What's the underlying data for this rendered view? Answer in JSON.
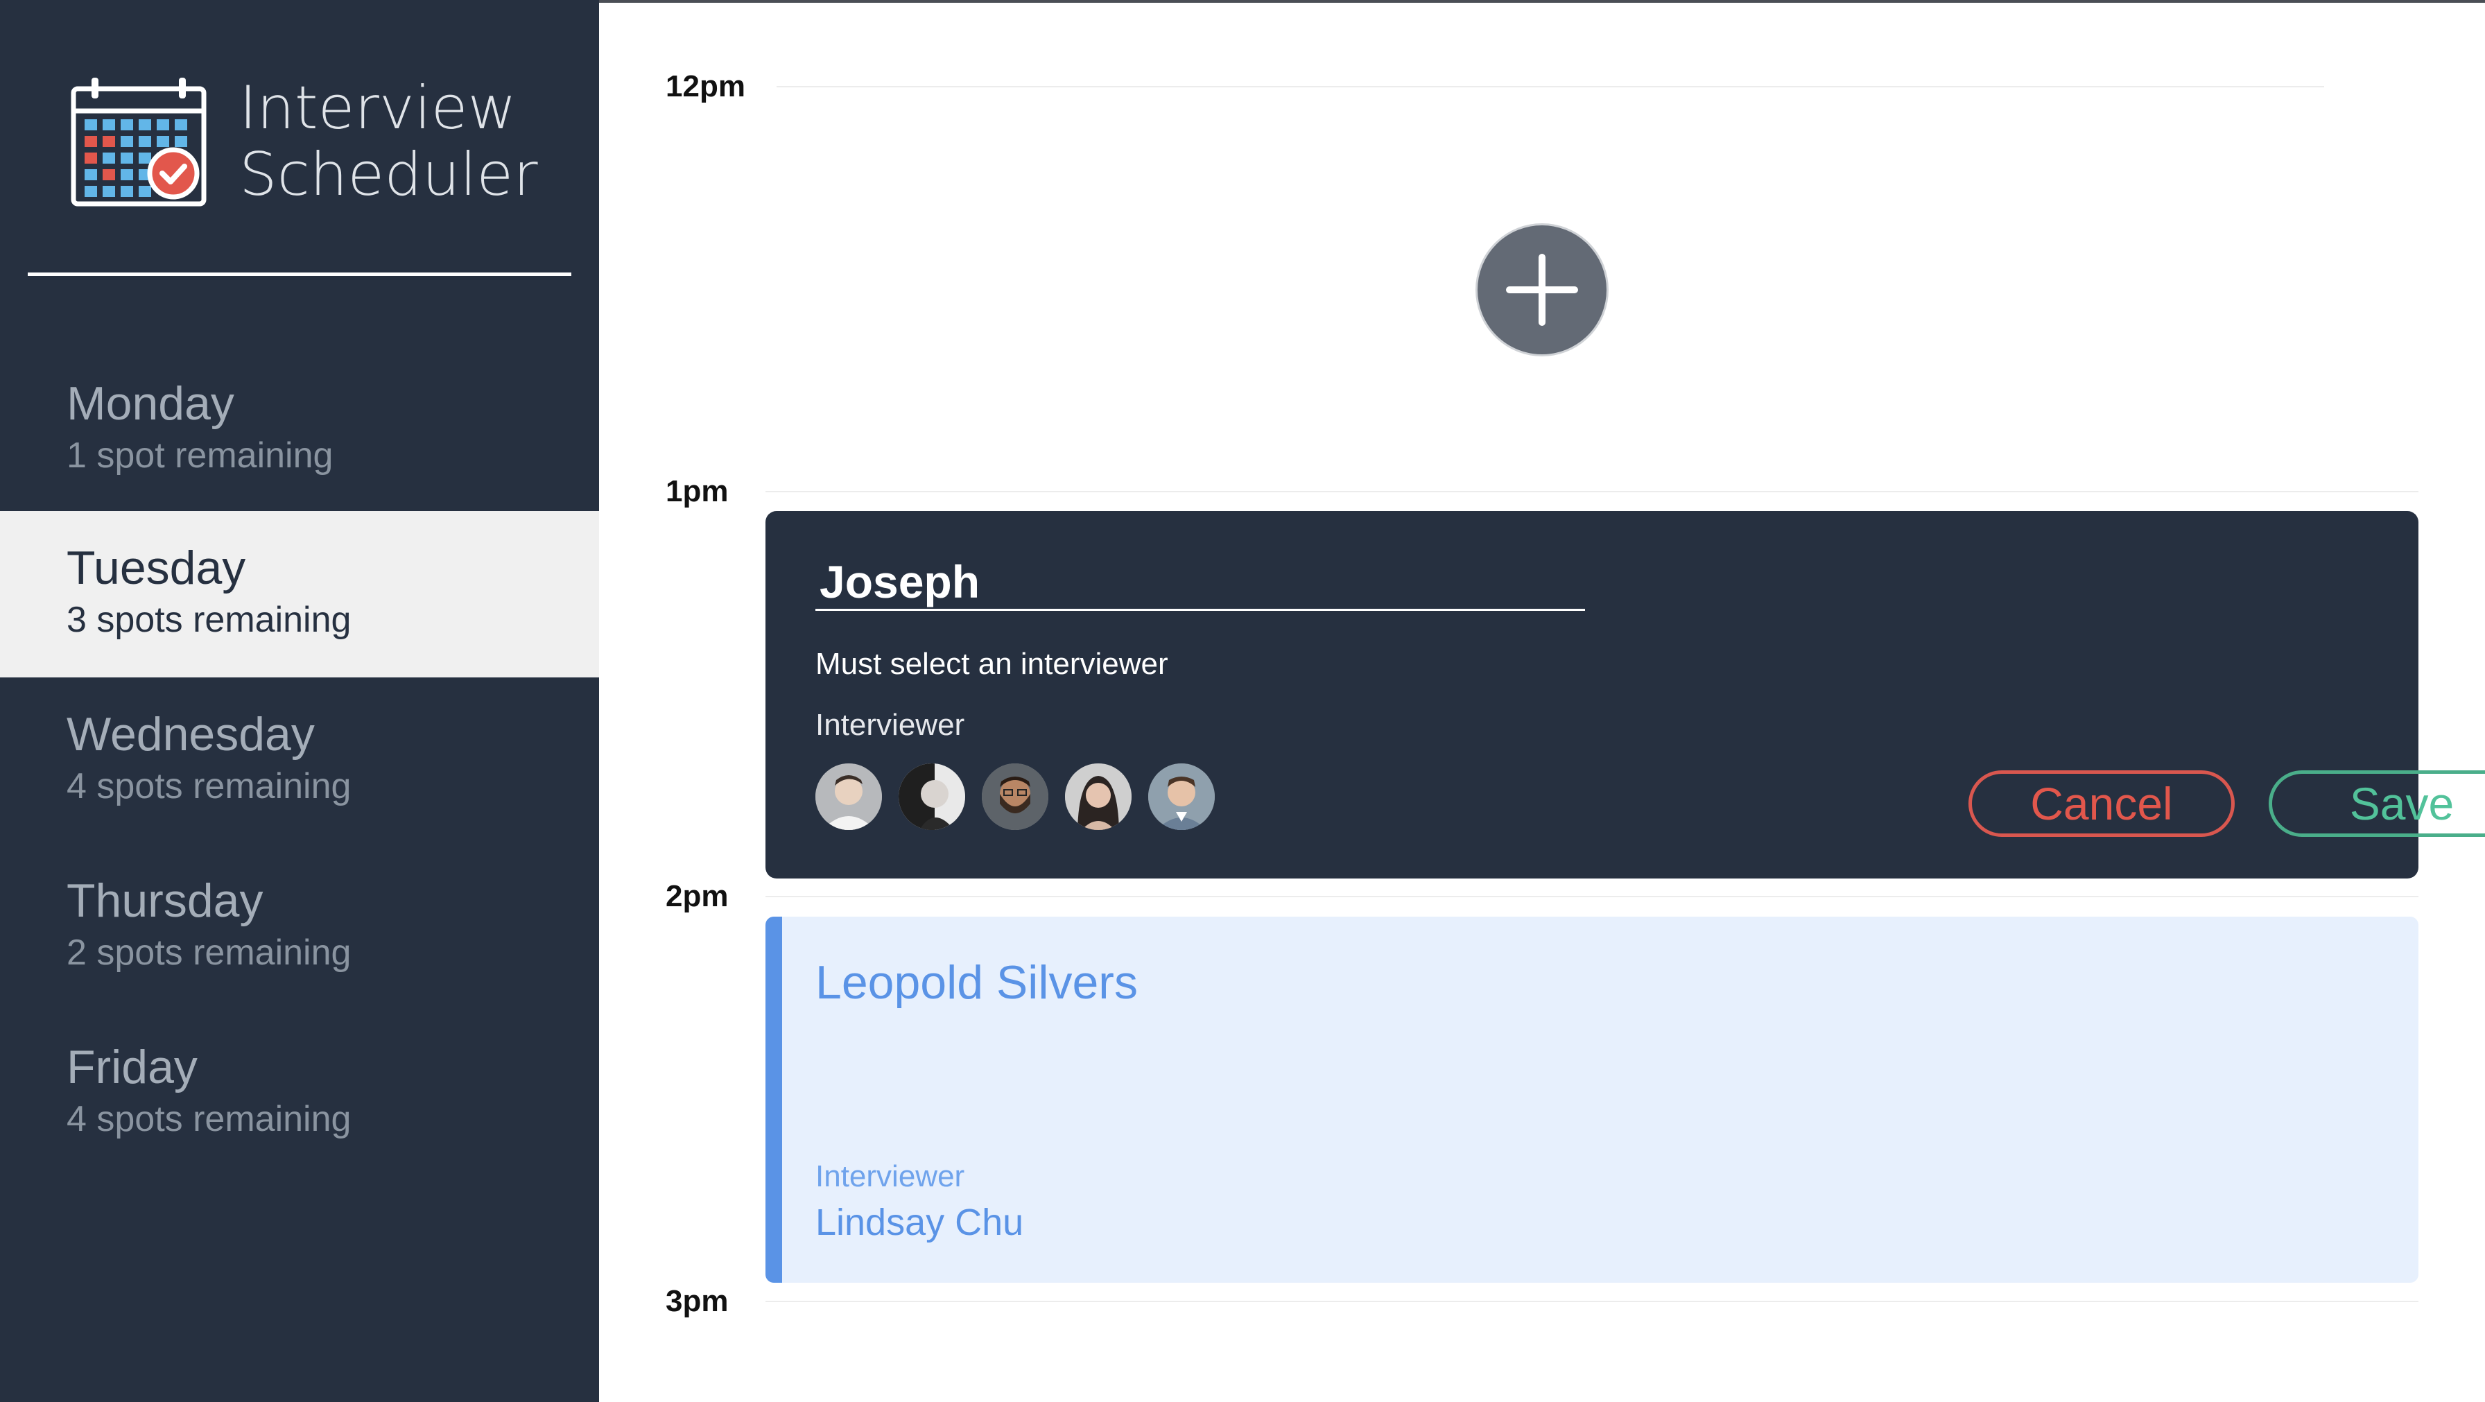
{
  "app": {
    "title_line1": "Interview",
    "title_line2": "Scheduler"
  },
  "days": [
    {
      "name": "Monday",
      "spots": "1 spot remaining",
      "selected": false
    },
    {
      "name": "Tuesday",
      "spots": "3 spots remaining",
      "selected": true
    },
    {
      "name": "Wednesday",
      "spots": "4 spots remaining",
      "selected": false
    },
    {
      "name": "Thursday",
      "spots": "2 spots remaining",
      "selected": false
    },
    {
      "name": "Friday",
      "spots": "4 spots remaining",
      "selected": false
    }
  ],
  "schedule": {
    "times": [
      "12pm",
      "1pm",
      "2pm",
      "3pm"
    ]
  },
  "form": {
    "student_name": "Joseph",
    "validation": "Must select an interviewer",
    "interviewer_label": "Interviewer",
    "avatars": [
      "interviewer-avatar-1",
      "interviewer-avatar-2",
      "interviewer-avatar-3",
      "interviewer-avatar-4",
      "interviewer-avatar-5"
    ],
    "cancel_label": "Cancel",
    "save_label": "Save"
  },
  "appointment": {
    "student": "Leopold Silvers",
    "interviewer_label": "Interviewer",
    "interviewer_name": "Lindsay Chu"
  },
  "colors": {
    "sidebar_bg": "#263040",
    "selected_day_bg": "#f0f0f0",
    "cancel": "#e2574c",
    "save": "#52c29a",
    "appointment_accent": "#5a93e6",
    "appointment_bg": "#e7f0fd"
  },
  "icons": {
    "logo": "calendar-check-icon",
    "add": "plus-icon"
  }
}
